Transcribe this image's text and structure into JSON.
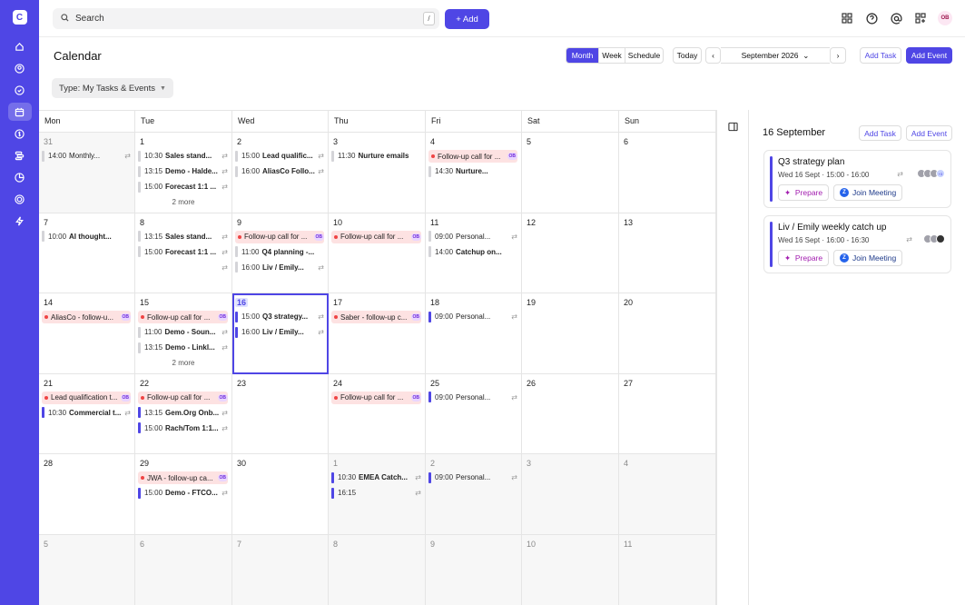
{
  "app": {
    "logo_letter": "C"
  },
  "topbar": {
    "search_placeholder": "Search",
    "search_shortcut": "/",
    "add_label": "+ Add",
    "avatar_initials": "OB"
  },
  "page": {
    "title": "Calendar",
    "type_filter_label": "Type:",
    "type_filter_value": "My Tasks & Events"
  },
  "toolbar": {
    "views": [
      "Month",
      "Week",
      "Schedule"
    ],
    "active_view": "Month",
    "today_label": "Today",
    "current_period": "September 2026",
    "add_task_label": "Add Task",
    "add_event_label": "Add Event"
  },
  "weekdays": [
    "Mon",
    "Tue",
    "Wed",
    "Thu",
    "Fri",
    "Sat",
    "Sun"
  ],
  "weeks": [
    [
      {
        "day": "31",
        "muted": true,
        "events": [
          {
            "kind": "gray",
            "time": "14:00",
            "title": "Monthly...",
            "repeat": true,
            "normal": true
          }
        ]
      },
      {
        "day": "1",
        "events": [
          {
            "kind": "gray",
            "time": "10:30",
            "title": "Sales stand...",
            "repeat": true
          },
          {
            "kind": "gray",
            "time": "13:15",
            "title": "Demo - Halde...",
            "repeat": true
          },
          {
            "kind": "gray",
            "time": "15:00",
            "title": "Forecast 1:1 ...",
            "repeat": true
          }
        ],
        "more": "2 more"
      },
      {
        "day": "2",
        "events": [
          {
            "kind": "gray",
            "time": "15:00",
            "title": "Lead qualific...",
            "repeat": true
          },
          {
            "kind": "gray",
            "time": "16:00",
            "title": "AliasCo Follo...",
            "repeat": true
          }
        ]
      },
      {
        "day": "3",
        "events": [
          {
            "kind": "gray",
            "time": "11:30",
            "title": "Nurture emails",
            "long": true
          }
        ]
      },
      {
        "day": "4",
        "events": [
          {
            "kind": "red",
            "title": "Follow-up call for ...",
            "badge": "OB"
          },
          {
            "kind": "gray",
            "time": "14:30",
            "title": "Nurture..."
          }
        ]
      },
      {
        "day": "5",
        "events": []
      },
      {
        "day": "6",
        "events": []
      }
    ],
    [
      {
        "day": "7",
        "events": [
          {
            "kind": "gray",
            "time": "10:00",
            "title": "AI thought...",
            "long": true
          }
        ]
      },
      {
        "day": "8",
        "events": [
          {
            "kind": "gray",
            "time": "13:15",
            "title": "Sales stand...",
            "repeat": true
          },
          {
            "kind": "gray",
            "time": "15:00",
            "title": "Forecast 1:1 ...",
            "repeat": true
          },
          {
            "kind": "none",
            "time": "",
            "title": "",
            "repeat": true
          }
        ]
      },
      {
        "day": "9",
        "events": [
          {
            "kind": "red",
            "title": "Follow-up call for ...",
            "badge": "OB"
          },
          {
            "kind": "gray",
            "time": "11:00",
            "title": "Q4 planning -...",
            "long": true
          },
          {
            "kind": "gray",
            "time": "16:00",
            "title": "Liv / Emily...",
            "repeat": true
          }
        ]
      },
      {
        "day": "10",
        "events": [
          {
            "kind": "red",
            "title": "Follow-up call for ...",
            "badge": "OB"
          }
        ]
      },
      {
        "day": "11",
        "events": [
          {
            "kind": "gray",
            "time": "09:00",
            "title": "Personal...",
            "repeat": true,
            "normal": true
          },
          {
            "kind": "gray",
            "time": "14:00",
            "title": "Catchup on...",
            "long": true
          }
        ]
      },
      {
        "day": "12",
        "events": []
      },
      {
        "day": "13",
        "events": []
      }
    ],
    [
      {
        "day": "14",
        "events": [
          {
            "kind": "red",
            "title": "AliasCo - follow-u...",
            "badge": "OB"
          }
        ]
      },
      {
        "day": "15",
        "events": [
          {
            "kind": "red",
            "title": "Follow-up call for ...",
            "badge": "OB"
          },
          {
            "kind": "gray",
            "time": "11:00",
            "title": "Demo - Soun...",
            "repeat": true
          },
          {
            "kind": "gray",
            "time": "13:15",
            "title": "Demo - Linkl...",
            "repeat": true
          }
        ],
        "more": "2 more"
      },
      {
        "day": "16",
        "today": true,
        "events": [
          {
            "kind": "blue",
            "time": "15:00",
            "title": "Q3 strategy...",
            "repeat": true
          },
          {
            "kind": "blue",
            "time": "16:00",
            "title": "Liv / Emily...",
            "repeat": true
          }
        ]
      },
      {
        "day": "17",
        "events": [
          {
            "kind": "red",
            "title": "Saber - follow-up c...",
            "badge": "OB"
          }
        ]
      },
      {
        "day": "18",
        "events": [
          {
            "kind": "blue",
            "time": "09:00",
            "title": "Personal...",
            "repeat": true,
            "normal": true
          }
        ]
      },
      {
        "day": "19",
        "events": []
      },
      {
        "day": "20",
        "events": []
      }
    ],
    [
      {
        "day": "21",
        "events": [
          {
            "kind": "red",
            "title": "Lead qualification t...",
            "badge": "OB"
          },
          {
            "kind": "blue",
            "time": "10:30",
            "title": "Commercial t...",
            "repeat": true
          }
        ]
      },
      {
        "day": "22",
        "events": [
          {
            "kind": "red",
            "title": "Follow-up call for ...",
            "badge": "OB"
          },
          {
            "kind": "blue",
            "time": "13:15",
            "title": "Gem.Org Onb...",
            "repeat": true
          },
          {
            "kind": "blue",
            "time": "15:00",
            "title": "Rach/Tom 1:1...",
            "repeat": true
          }
        ]
      },
      {
        "day": "23",
        "events": []
      },
      {
        "day": "24",
        "events": [
          {
            "kind": "red",
            "title": "Follow-up call for ...",
            "badge": "OB"
          }
        ]
      },
      {
        "day": "25",
        "events": [
          {
            "kind": "blue",
            "time": "09:00",
            "title": "Personal...",
            "repeat": true,
            "normal": true
          }
        ]
      },
      {
        "day": "26",
        "events": []
      },
      {
        "day": "27",
        "events": []
      }
    ],
    [
      {
        "day": "28",
        "events": []
      },
      {
        "day": "29",
        "events": [
          {
            "kind": "red",
            "title": "JWA - follow-up ca...",
            "badge": "OB"
          },
          {
            "kind": "blue",
            "time": "15:00",
            "title": "Demo - FTCO...",
            "repeat": true
          }
        ]
      },
      {
        "day": "30",
        "events": []
      },
      {
        "day": "1",
        "muted": true,
        "events": [
          {
            "kind": "blue",
            "time": "10:30",
            "title": "EMEA Catch...",
            "repeat": true
          },
          {
            "kind": "blue",
            "time": "16:15",
            "title": "",
            "repeat": true
          }
        ]
      },
      {
        "day": "2",
        "muted": true,
        "events": [
          {
            "kind": "blue",
            "time": "09:00",
            "title": "Personal...",
            "repeat": true,
            "normal": true
          }
        ]
      },
      {
        "day": "3",
        "muted": true,
        "events": []
      },
      {
        "day": "4",
        "muted": true,
        "events": []
      }
    ],
    [
      {
        "day": "5",
        "muted": true,
        "events": []
      },
      {
        "day": "6",
        "muted": true,
        "events": []
      },
      {
        "day": "7",
        "muted": true,
        "events": []
      },
      {
        "day": "8",
        "muted": true,
        "events": []
      },
      {
        "day": "9",
        "muted": true,
        "events": []
      },
      {
        "day": "10",
        "muted": true,
        "events": []
      },
      {
        "day": "11",
        "muted": true,
        "events": []
      }
    ]
  ],
  "side_panel": {
    "date": "16 September",
    "add_task_label": "Add Task",
    "add_event_label": "Add Event",
    "events": [
      {
        "title": "Q3 strategy plan",
        "subtitle": "Wed 16 Sept · 15:00 - 16:00",
        "prepare_label": "Prepare",
        "join_label": "Join Meeting",
        "attendee_badge": "+3"
      },
      {
        "title": "Liv / Emily weekly catch up",
        "subtitle": "Wed 16 Sept · 16:00 - 16:30",
        "prepare_label": "Prepare",
        "join_label": "Join Meeting"
      }
    ]
  },
  "icons": {
    "rail": [
      "home-icon",
      "contacts-icon",
      "tasks-icon",
      "calendar-icon",
      "deals-icon",
      "pipelines-icon",
      "reports-icon",
      "goals-icon",
      "automations-icon"
    ],
    "top": [
      "apps-grid-icon",
      "help-icon",
      "mentions-icon",
      "integrations-icon"
    ],
    "repeat_glyph": "⇄"
  },
  "colors": {
    "accent": "#4f46e5",
    "event_red_bg": "#fde2e2",
    "event_red_dot": "#ef4444",
    "event_gray_bar": "#d4d4d8",
    "muted_cell": "#f7f7f7"
  }
}
